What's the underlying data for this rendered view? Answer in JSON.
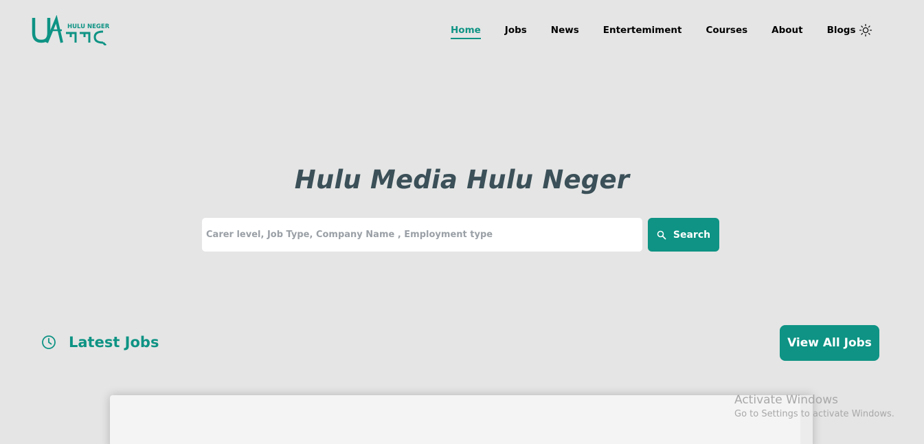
{
  "brand": {
    "name": "HULU NEGER",
    "accent_color": "#0e9384",
    "logo_icon": "hulu-neger-logo"
  },
  "nav": {
    "items": [
      {
        "label": "Home",
        "active": true
      },
      {
        "label": "Jobs",
        "active": false
      },
      {
        "label": "News",
        "active": false
      },
      {
        "label": "Entertemiment",
        "active": false
      },
      {
        "label": "Courses",
        "active": false
      },
      {
        "label": "About",
        "active": false
      },
      {
        "label": "Blogs",
        "active": false
      }
    ],
    "theme_toggle_icon": "sun-icon"
  },
  "hero": {
    "title": "Hulu Media Hulu Neger",
    "search_placeholder": "Carer level, Job Type, Company Name , Employment type",
    "search_value": "",
    "search_button_label": "Search",
    "search_icon": "search-icon"
  },
  "latest_jobs": {
    "title": "Latest Jobs",
    "icon": "clock-icon",
    "view_all_label": "View All Jobs"
  },
  "watermark": {
    "line1": "Activate Windows",
    "line2": "Go to Settings to activate Windows."
  },
  "colors": {
    "background": "#e5e5e5",
    "title_text": "#3b5058",
    "primary": "#0e9384"
  }
}
